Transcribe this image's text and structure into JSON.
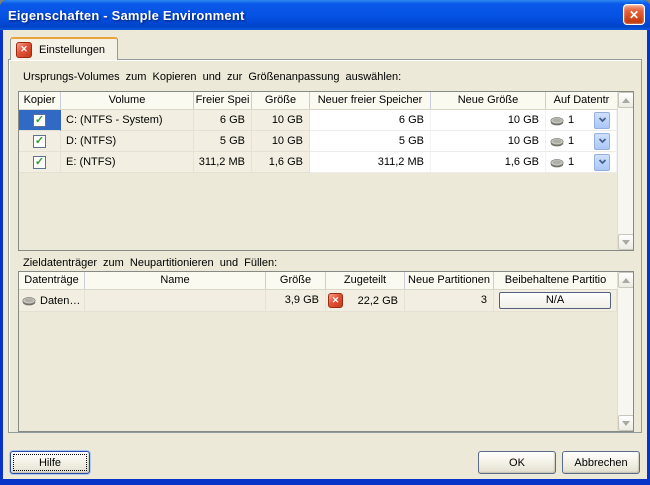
{
  "window": {
    "title": "Eigenschaften - Sample Environment"
  },
  "tab": {
    "label": "Einstellungen"
  },
  "source_table": {
    "label": "Ursprungs-Volumes zum Kopieren und zur Größenanpassung auswählen:",
    "columns": [
      "Kopier",
      "Volume",
      "Freier Spei",
      "Größe",
      "Neuer freier Speicher",
      "Neue Größe",
      "Auf Datentr"
    ],
    "rows": [
      {
        "checked": true,
        "selected": true,
        "volume": "C: (NTFS - System)",
        "free": "6 GB",
        "size": "10 GB",
        "new_free": "6 GB",
        "new_size": "10 GB",
        "disk_count": "1"
      },
      {
        "checked": true,
        "selected": false,
        "volume": "D: (NTFS)",
        "free": "5 GB",
        "size": "10 GB",
        "new_free": "5 GB",
        "new_size": "10 GB",
        "disk_count": "1"
      },
      {
        "checked": true,
        "selected": false,
        "volume": "E: (NTFS)",
        "free": "311,2 MB",
        "size": "1,6 GB",
        "new_free": "311,2 MB",
        "new_size": "1,6 GB",
        "disk_count": "1"
      }
    ]
  },
  "target_table": {
    "label": "Zieldatenträger zum Neupartitionieren und Füllen:",
    "columns": [
      "Datenträge",
      "Name",
      "Größe",
      "Zugeteilt",
      "Neue Partitionen",
      "Beibehaltene Partitio"
    ],
    "rows": [
      {
        "device": "Daten…",
        "name": "",
        "size": "3,9 GB",
        "allocated": "22,2 GB",
        "warning": true,
        "new_partitions": "3",
        "kept_partitions": "N/A"
      }
    ]
  },
  "buttons": {
    "help": "Hilfe",
    "ok": "OK",
    "cancel": "Abbrechen"
  },
  "icons": {
    "close": "close-x",
    "tab_badge": "red-x-badge",
    "allocation_warning": "red-x-badge",
    "disk": "hard-disk",
    "dropdown": "chevron-down",
    "scroll_up": "arrow-up",
    "scroll_down": "arrow-down"
  },
  "colors": {
    "titlebar_blue": "#0451E4",
    "window_border_blue": "#0833C9",
    "dialog_bg": "#ECE9D8",
    "selection_blue": "#316AC5",
    "check_green": "#2DA12D",
    "warning_red": "#D23A18",
    "tab_accent_orange": "#E8A33D",
    "header_bg": "#FBFAF1",
    "row_bg": "#F2EFE2",
    "editable_bg": "#FFFFFF",
    "dropdown_blue": "#ABC7F7"
  }
}
